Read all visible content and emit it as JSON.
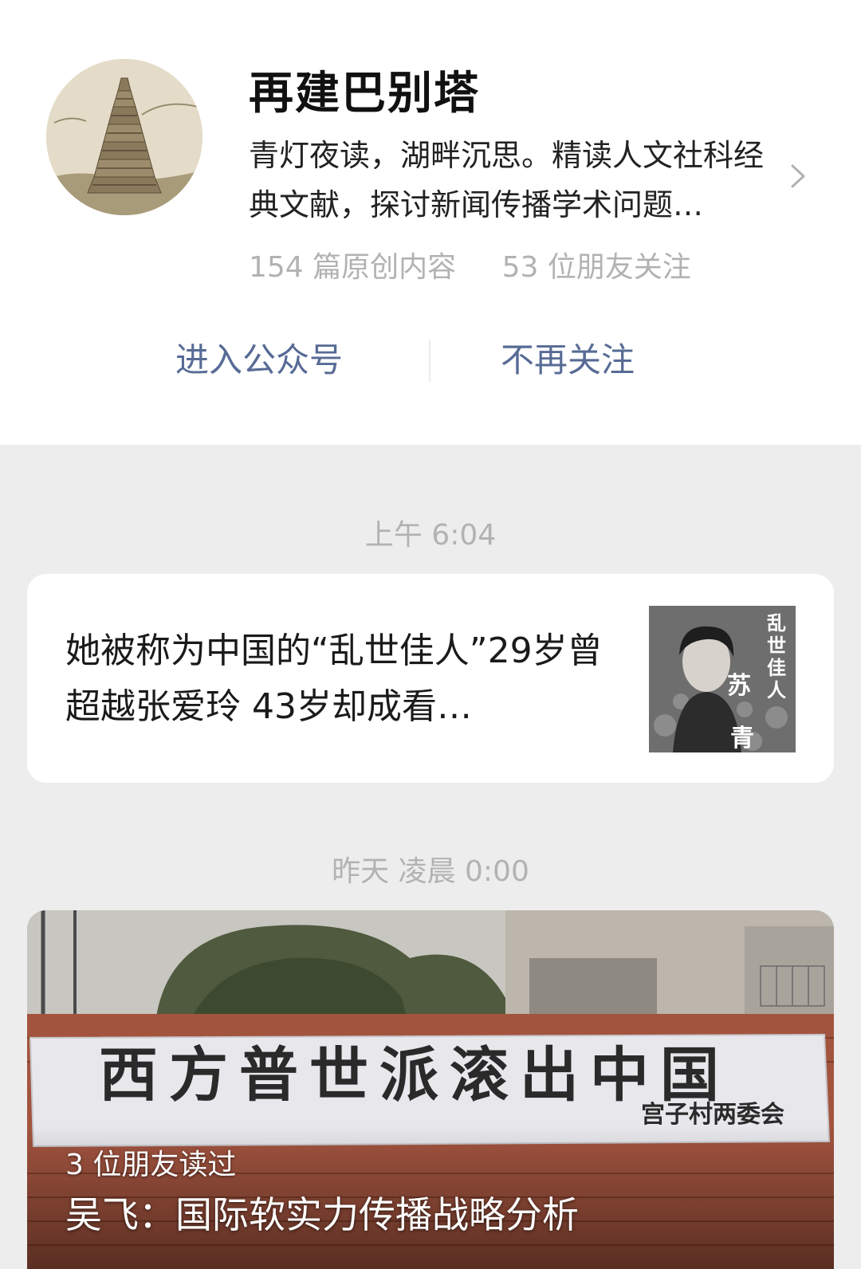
{
  "profile": {
    "name": "再建巴别塔",
    "description": "青灯夜读，湖畔沉思。精读人文社科经典文献，探讨新闻传播学术问题…",
    "original_count": "154 篇原创内容",
    "friends_following": "53 位朋友关注",
    "enter_label": "进入公众号",
    "unfollow_label": "不再关注",
    "avatar_icon": "tower-of-babel-engraving"
  },
  "feed": [
    {
      "time": "上午 6:04",
      "title": "她被称为中国的“乱世佳人”29岁曾超越张爱玲 43岁却成看…",
      "thumb_text": "乱世佳人",
      "thumb_name": "苏青"
    },
    {
      "time": "昨天 凌晨 0:00",
      "readers": "3 位朋友读过",
      "title": "吴飞：国际软实力传播战略分析",
      "banner_text": "西方普世派滚出中国",
      "banner_sub": "宫子村两委会"
    }
  ],
  "colors": {
    "link": "#576b95",
    "muted": "#b2b2b2",
    "background": "#ededed"
  }
}
